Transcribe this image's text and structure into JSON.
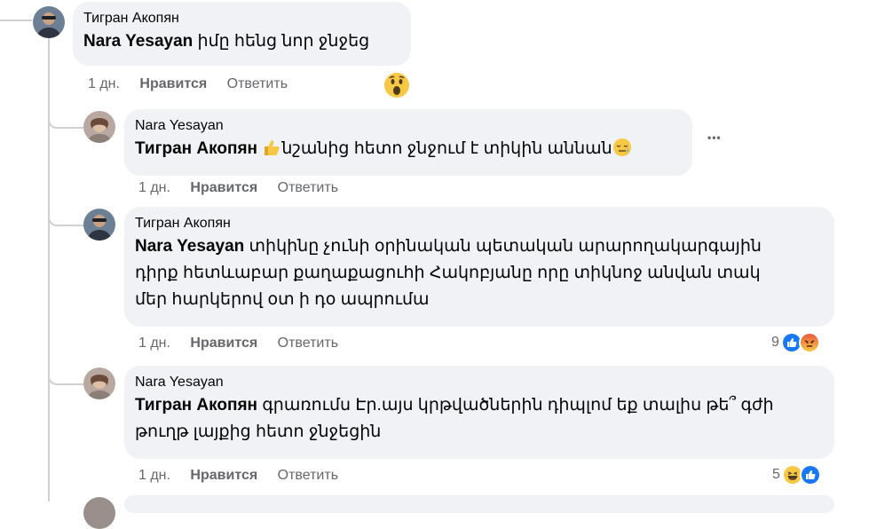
{
  "comments": [
    {
      "author": "Тигран Акопян",
      "mention": "Nara Yesayan",
      "text": "իմը հենց նոր ջնջեց",
      "time": "1 дн.",
      "like": "Нравится",
      "reply": "Ответить",
      "reaction_icon": "wow-emoji"
    },
    {
      "author": "Nara Yesayan",
      "mention": "Тигран Акопян",
      "text_before": "նշանից հետո ջնջում է տիկին աննան",
      "time": "1 дн.",
      "like": "Нравится",
      "reply": "Ответить",
      "more": "•••",
      "emoji_inline": [
        "thumbs-up-emoji",
        "sleepy-emoji"
      ]
    },
    {
      "author": "Тигран Акопян",
      "mention": "Nara Yesayan",
      "text_line1": "տիկինը չունի օրինական պետական արարողակարգային",
      "text_line2": "դիրք հետևաբար քաղաքացուհի Հակոբյանը որը տիկնոջ անվան տակ",
      "text_line3": "մեր հարկերով օտ ի դօ ապրումա",
      "time": "1 дн.",
      "like": "Нравится",
      "reply": "Ответить",
      "reaction_count": "9",
      "reactions": [
        "like-icon",
        "angry-icon"
      ]
    },
    {
      "author": "Nara Yesayan",
      "mention": "Тигран Акопян",
      "text_line1": "գրառումս Էր.այս կրթվածներին դիպլոմ եք տալիս թե՞ գժի",
      "text_line2": "թուղթ լայքից հետո ջնջեցին",
      "time": "1 дн.",
      "like": "Нравится",
      "reply": "Ответить",
      "reaction_count": "5",
      "reactions": [
        "haha-icon",
        "like-icon"
      ]
    }
  ],
  "colors": {
    "bubble": "#f0f2f5",
    "meta": "#65676b",
    "thread_line": "#ced0d4",
    "like_blue": "#1877f2"
  }
}
